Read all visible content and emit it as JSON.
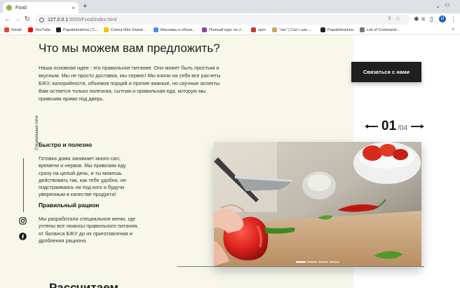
{
  "browser": {
    "tab_title": "Food",
    "tab_close": "×",
    "new_tab": "+",
    "url_host": "127.0.0.1",
    "url_path": ":5500/Food/index.html",
    "profile_initial": "И",
    "bookmarks": [
      {
        "label": "Gmail",
        "color": "#ea4335"
      },
      {
        "label": "YouTube",
        "color": "#ff0000"
      },
      {
        "label": "Papakhinalrina | C...",
        "color": "#222222"
      },
      {
        "label": "Cutout Mini Sweat...",
        "color": "#f4c400"
      },
      {
        "label": "Массивы и объек...",
        "color": "#4c8bf5"
      },
      {
        "label": "Полный курс по J...",
        "color": "#8e44ad"
      },
      {
        "label": "npm",
        "color": "#cb3837"
      },
      {
        "label": "\"var\" | Can I use....",
        "color": "#c5a572"
      },
      {
        "label": "Papakhinalrina",
        "color": "#222222"
      },
      {
        "label": "List of Command...",
        "color": "#777777"
      }
    ],
    "bookmarks_more": "»"
  },
  "page": {
    "heading": "Что мы можем вам предложить?",
    "intro": "Наша основная идея - это правильное питание. Оно может быть простым и вкусным. Мы не просто доставка, мы сервис! Мы взяли на себя все расчеты БЖУ, калорийности, объемов порций и прочие важные, но скучные аспекты. Вам остается только полезная, сытная и правильная еда, которую мы привозим прямо под дверь.",
    "contact_button": "Связаться с нами",
    "social_label": "Социальные сети",
    "features": [
      {
        "title": "Быстро и полезно",
        "text": "Готовка дома занимает много сил, времени и нервов. Мы привозим еду сразу на целый день, и ты можешь действовать так, как тебе удобно, не подстраиваясь ни под кого и будучи уверенным в качестве продукта!"
      },
      {
        "title": "Правильный рацион",
        "text": "Мы разработали специальное меню, где учтены все нюансы правильного питания, от баланса БЖУ до их приготовления и дробления рациона."
      }
    ],
    "slider": {
      "current": "01",
      "total": "/04",
      "dots": 4,
      "active_dot": 0
    },
    "next_heading": "Рассчитаем"
  },
  "colors": {
    "cream": "#f7f8ea",
    "button": "#1f1f1f"
  }
}
